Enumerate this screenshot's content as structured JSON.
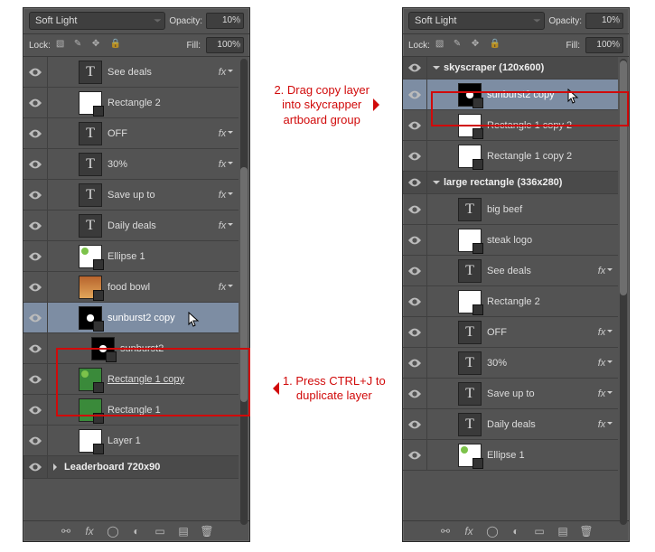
{
  "top": {
    "blend_mode": "Soft Light",
    "opacity_label": "Opacity:",
    "opacity_value": "10%",
    "lock_label": "Lock:",
    "fill_label": "Fill:",
    "fill_value": "100%"
  },
  "leftPanel": {
    "layers": [
      {
        "kind": "T",
        "name": "See deals",
        "fx": true
      },
      {
        "kind": "white",
        "name": "Rectangle 2"
      },
      {
        "kind": "T",
        "name": "OFF",
        "fx": true
      },
      {
        "kind": "T",
        "name": "30%",
        "fx": true
      },
      {
        "kind": "T",
        "name": "Save up to",
        "fx": true
      },
      {
        "kind": "T",
        "name": "Daily deals",
        "fx": true
      },
      {
        "kind": "ellipse",
        "name": "Ellipse 1",
        "dot": true
      },
      {
        "kind": "food",
        "name": "food bowl",
        "fx": true
      },
      {
        "kind": "img2",
        "name": "sunburst2 copy",
        "selected": true,
        "cursor": true
      },
      {
        "kind": "img2",
        "name": "sunburst2",
        "indent": true
      },
      {
        "kind": "green",
        "name": "Rectangle 1 copy",
        "dot": true,
        "underline": true
      },
      {
        "kind": "green",
        "name": "Rectangle 1"
      },
      {
        "kind": "white",
        "name": "Layer 1"
      }
    ],
    "group_bottom": "Leaderboard 720x90"
  },
  "rightPanel": {
    "group_top": "skyscraper (120x600)",
    "layers_top": [
      {
        "kind": "img2",
        "name": "sunburst2 copy",
        "selected": true,
        "cursor": true
      },
      {
        "kind": "white",
        "name": "Rectangle 1 copy 2",
        "small": true
      },
      {
        "kind": "white",
        "name": "Rectangle 1 copy 2",
        "small": true
      }
    ],
    "group_mid": "large rectangle (336x280)",
    "layers_mid": [
      {
        "kind": "T",
        "name": "big beef"
      },
      {
        "kind": "white",
        "name": "steak logo"
      },
      {
        "kind": "T",
        "name": "See deals",
        "fx": true
      },
      {
        "kind": "white",
        "name": "Rectangle 2"
      },
      {
        "kind": "T",
        "name": "OFF",
        "fx": true
      },
      {
        "kind": "T",
        "name": "30%",
        "fx": true
      },
      {
        "kind": "T",
        "name": "Save up to",
        "fx": true
      },
      {
        "kind": "T",
        "name": "Daily deals",
        "fx": true
      },
      {
        "kind": "ellipse",
        "name": "Ellipse 1",
        "dot": true
      }
    ]
  },
  "annotations": {
    "a1": "1. Press CTRL+J to\nduplicate layer",
    "a2": "2. Drag copy layer\ninto skycrapper\nartboard group"
  }
}
